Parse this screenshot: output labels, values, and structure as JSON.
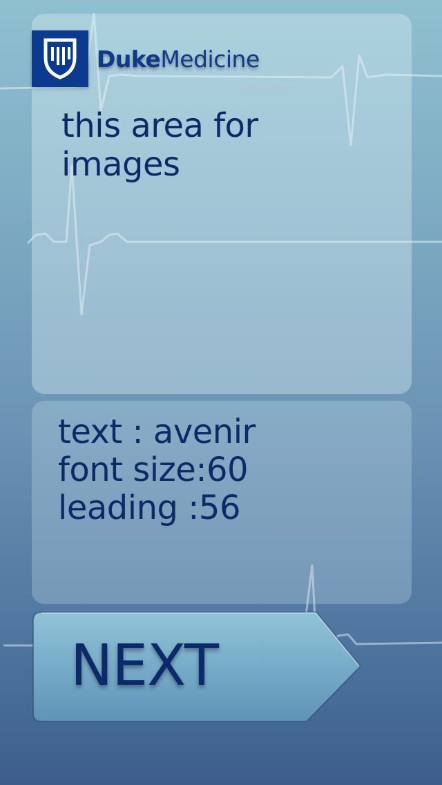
{
  "brand": {
    "name_bold": "Duke",
    "name_regular": "Medicine",
    "logo_icon": "duke-chapel-shield-icon",
    "logo_color": "#0c3a8f"
  },
  "image_area": {
    "placeholder": "this area for images"
  },
  "text_area": {
    "lines": [
      "text : avenir",
      "font size:60",
      "leading :56"
    ]
  },
  "next_button": {
    "label": "NEXT",
    "icon": "arrow-right-icon"
  },
  "background": {
    "gradient_top": "#8fc0d0",
    "gradient_bottom": "#3d5e8c",
    "decoration": "heartbeat-line"
  }
}
